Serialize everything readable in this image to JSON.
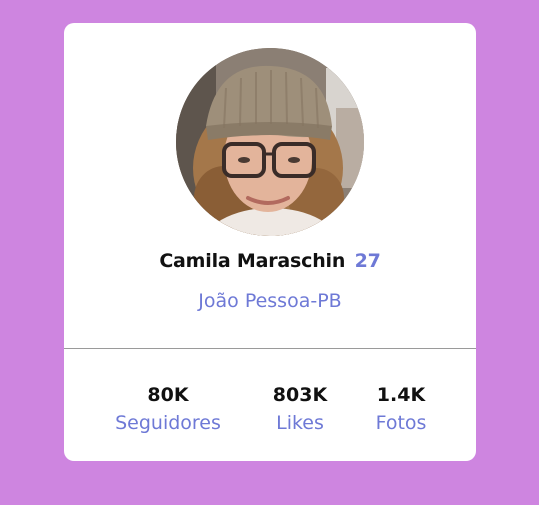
{
  "profile": {
    "name": "Camila Maraschin",
    "age": "27",
    "location": "João Pessoa-PB",
    "avatar_icon": "profile-photo"
  },
  "stats": [
    {
      "value": "80K",
      "label": "Seguidores"
    },
    {
      "value": "803K",
      "label": "Likes"
    },
    {
      "value": "1.4K",
      "label": "Fotos"
    }
  ],
  "colors": {
    "background": "#ce85e0",
    "card": "#ffffff",
    "accent": "#6e79d6",
    "text": "#111111"
  }
}
